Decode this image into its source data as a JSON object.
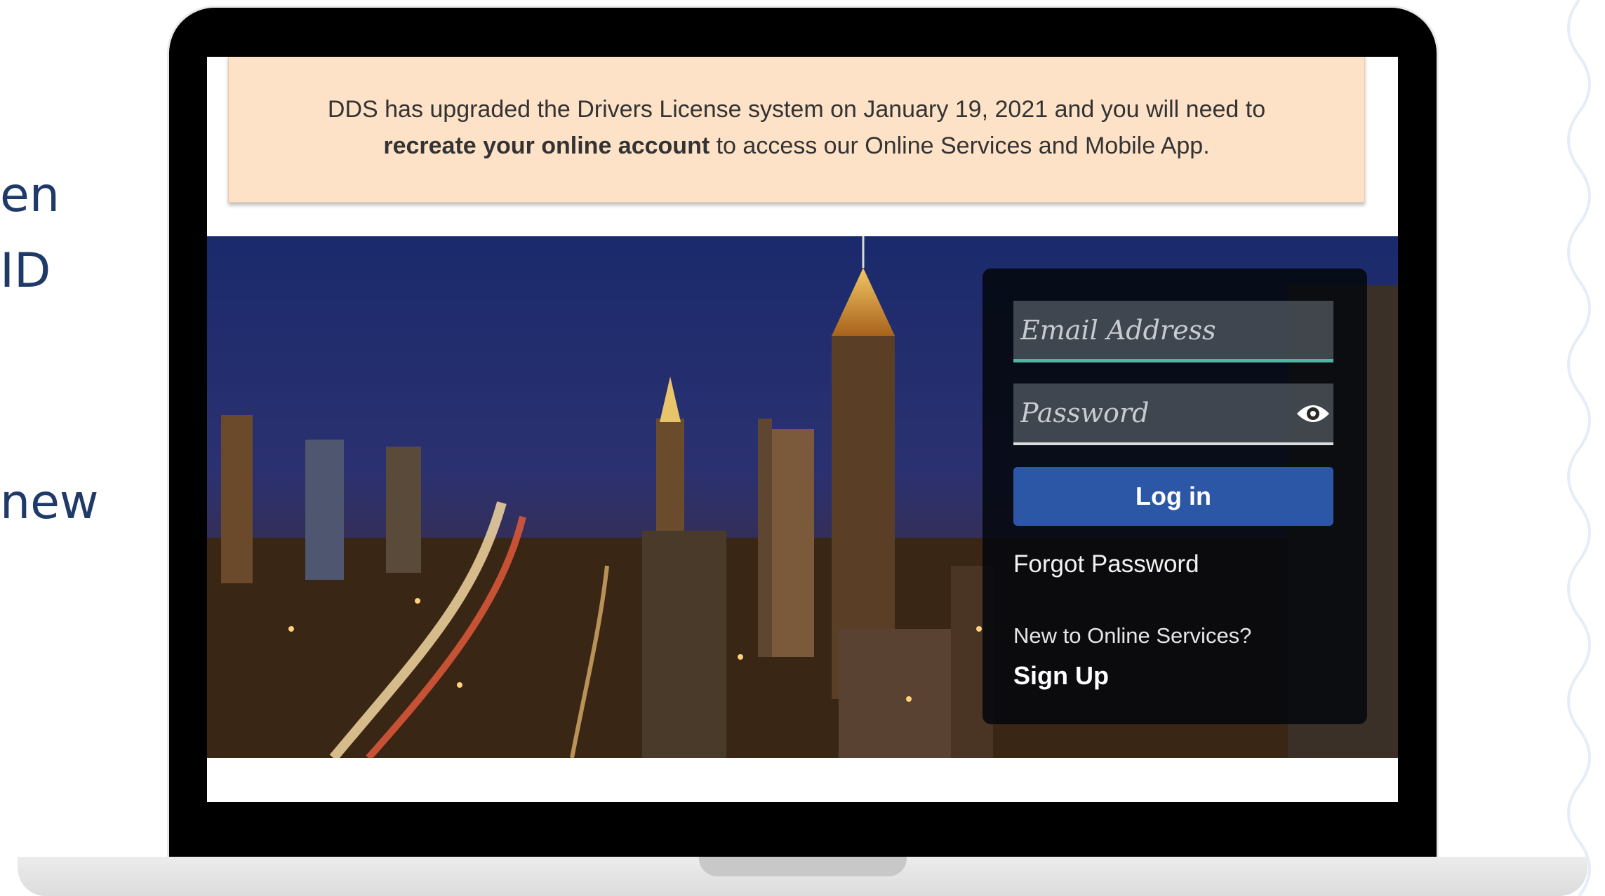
{
  "side_fragments": [
    "en",
    "ID",
    "new"
  ],
  "notice": {
    "line1": "DDS has upgraded the Drivers License system on January 19, 2021 and you will need to",
    "line2_bold": "recreate your online account",
    "line2_rest": " to access our Online Services and Mobile App."
  },
  "login": {
    "email_placeholder": "Email Address",
    "password_placeholder": "Password",
    "login_button": "Log in",
    "forgot_password": "Forgot Password",
    "new_user_prompt": "New to Online Services?",
    "signup_link": "Sign Up"
  },
  "icons": {
    "password_toggle": "eye-icon"
  },
  "colors": {
    "notice_bg": "#fde2c8",
    "login_button": "#2c57a6",
    "email_focus_underline": "#4fb6a4",
    "side_text": "#1f3a68"
  }
}
